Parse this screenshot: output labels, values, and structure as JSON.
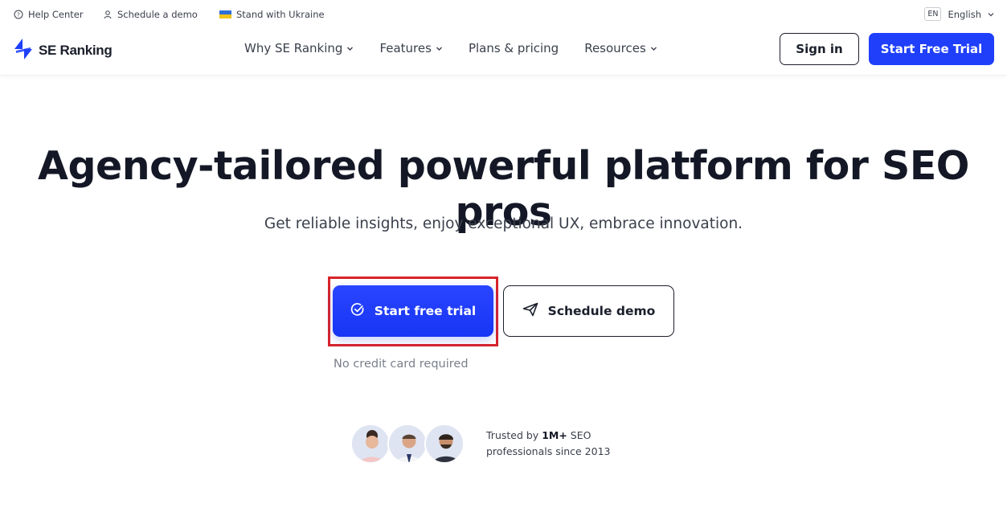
{
  "topbar": {
    "help": "Help Center",
    "schedule": "Schedule a demo",
    "ukraine": "Stand with Ukraine",
    "lang_code": "EN",
    "lang_name": "English"
  },
  "header": {
    "logo": "SE Ranking",
    "nav": {
      "why": "Why SE Ranking",
      "features": "Features",
      "pricing": "Plans & pricing",
      "resources": "Resources"
    },
    "signin": "Sign in",
    "trial": "Start Free Trial"
  },
  "hero": {
    "title": "Agency-tailored powerful platform for SEO pros",
    "subtitle": "Get reliable insights, enjoy exceptional UX, embrace innovation.",
    "cta_primary": "Start free trial",
    "cta_secondary": "Schedule demo",
    "note": "No credit card required"
  },
  "trust": {
    "prefix": "Trusted by ",
    "count": "1M+",
    "suffix": " SEO",
    "line2": "professionals since 2013"
  },
  "colors": {
    "brand_blue": "#1f3ffb",
    "highlight_red": "#d8232a"
  },
  "icons": [
    "help-icon",
    "user-icon",
    "ukraine-flag-icon",
    "chevron-down-icon",
    "check-circle-icon",
    "send-icon",
    "logo-icon"
  ]
}
